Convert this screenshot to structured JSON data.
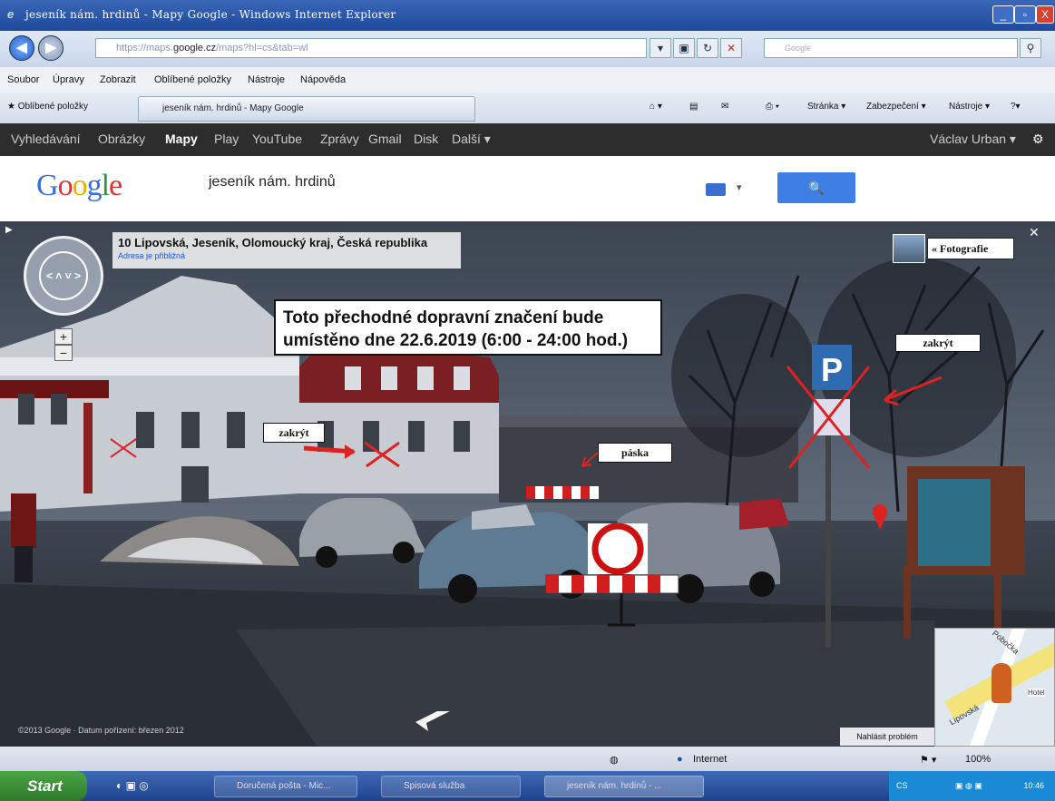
{
  "window": {
    "title": "jeseník nám. hrdinů - Mapy Google - Windows Internet Explorer",
    "min": "_",
    "max": "▫",
    "close": "X"
  },
  "address": {
    "url_prefix": "https://maps.",
    "url_domain": "google.cz",
    "url_rest": "/maps?hl=cs&tab=wl",
    "search_placeholder": "Google",
    "back": "◀",
    "forward": "▶"
  },
  "menu": [
    "Soubor",
    "Úpravy",
    "Zobrazit",
    "Oblíbené položky",
    "Nástroje",
    "Nápověda"
  ],
  "favorites": {
    "label": "Oblíbené položky",
    "tab": "jeseník nám. hrdinů - Mapy Google"
  },
  "command_bar": [
    "Stránka ▾",
    "Zabezpečení ▾",
    "Nástroje ▾"
  ],
  "google_bar": {
    "items": [
      "Vyhledávání",
      "Obrázky",
      "Mapy",
      "Play",
      "YouTube",
      "Zprávy",
      "Gmail",
      "Disk",
      "Další ▾"
    ],
    "user": "Václav Urban ▾",
    "gear": "⚙"
  },
  "search": {
    "query": "jeseník nám. hrdinů",
    "button": "🔍"
  },
  "streetview": {
    "address": "10 Lipovská, Jeseník, Olomoucký kraj, Česká republika",
    "address_note": "Adresa je přibližná",
    "notice": "Toto přechodné dopravní značení bude umístěno dne 22.6.2019 (6:00 - 24:00 hod.)",
    "label_left": "zakrýt",
    "label_right": "zakrýt",
    "label_tape": "páska",
    "photos": "« Fotografie",
    "copyright": "©2013 Google · Datum pořízení: březen 2012",
    "report": "Nahlásit problém",
    "zoom_in": "+",
    "zoom_out": "−",
    "map_labels": [
      "Pobočka",
      "Lipovská",
      "Hotel"
    ]
  },
  "status": {
    "zone": "Internet",
    "zoom": "100%"
  },
  "taskbar": {
    "start": "Start",
    "tasks": [
      "Doručená pošta - Mic...",
      "Spisová služba",
      "jeseník nám. hrdinů - ..."
    ],
    "locale": "CS",
    "time": "10:46"
  }
}
